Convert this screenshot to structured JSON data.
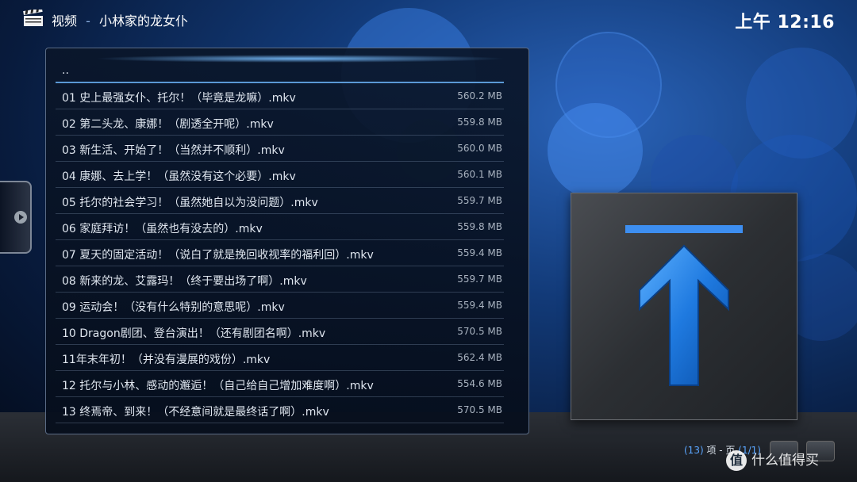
{
  "header": {
    "section": "视频",
    "separator": "-",
    "folder": "小林家的龙女仆",
    "clock": "上午 12:16"
  },
  "list": {
    "parent_label": "..",
    "items": [
      {
        "name": "01 史上最强女仆、托尔！（毕竟是龙嘛）.mkv",
        "size": "560.2 MB"
      },
      {
        "name": "02 第二头龙、康娜！（剧透全开呢）.mkv",
        "size": "559.8 MB"
      },
      {
        "name": "03 新生活、开始了！（当然并不顺利）.mkv",
        "size": "560.0 MB"
      },
      {
        "name": "04 康娜、去上学！（虽然没有这个必要）.mkv",
        "size": "560.1 MB"
      },
      {
        "name": "05 托尔的社会学习！（虽然她自以为没问题）.mkv",
        "size": "559.7 MB"
      },
      {
        "name": "06 家庭拜访！（虽然也有没去的）.mkv",
        "size": "559.8 MB"
      },
      {
        "name": "07 夏天的固定活动！（说白了就是挽回收视率的福利回）.mkv",
        "size": "559.4 MB"
      },
      {
        "name": "08 新来的龙、艾露玛！（终于要出场了啊）.mkv",
        "size": "559.7 MB"
      },
      {
        "name": "09 运动会！（没有什么特别的意思呢）.mkv",
        "size": "559.4 MB"
      },
      {
        "name": "10 Dragon剧团、登台演出！（还有剧团名啊）.mkv",
        "size": "570.5 MB"
      },
      {
        "name": "11年末年初！（并没有漫展的戏份）.mkv",
        "size": "562.4 MB"
      },
      {
        "name": "12 托尔与小林、感动的邂逅！（自己给自己增加难度啊）.mkv",
        "size": "554.6 MB"
      },
      {
        "name": "13 终焉帝、到来！（不经意间就是最终话了啊）.mkv",
        "size": "570.5 MB"
      }
    ]
  },
  "footer": {
    "count": "(13)",
    "items_word": "项 - 页",
    "page": "(1/1)"
  },
  "watermark": {
    "badge": "值",
    "text": "什么值得买"
  },
  "icons": {
    "header": "movie-clapperboard-icon",
    "thumbnail": "up-arrow-icon",
    "side": "chevron-right-icon"
  },
  "colors": {
    "accent": "#3d8ef0",
    "highlight": "#5aa6ff"
  }
}
